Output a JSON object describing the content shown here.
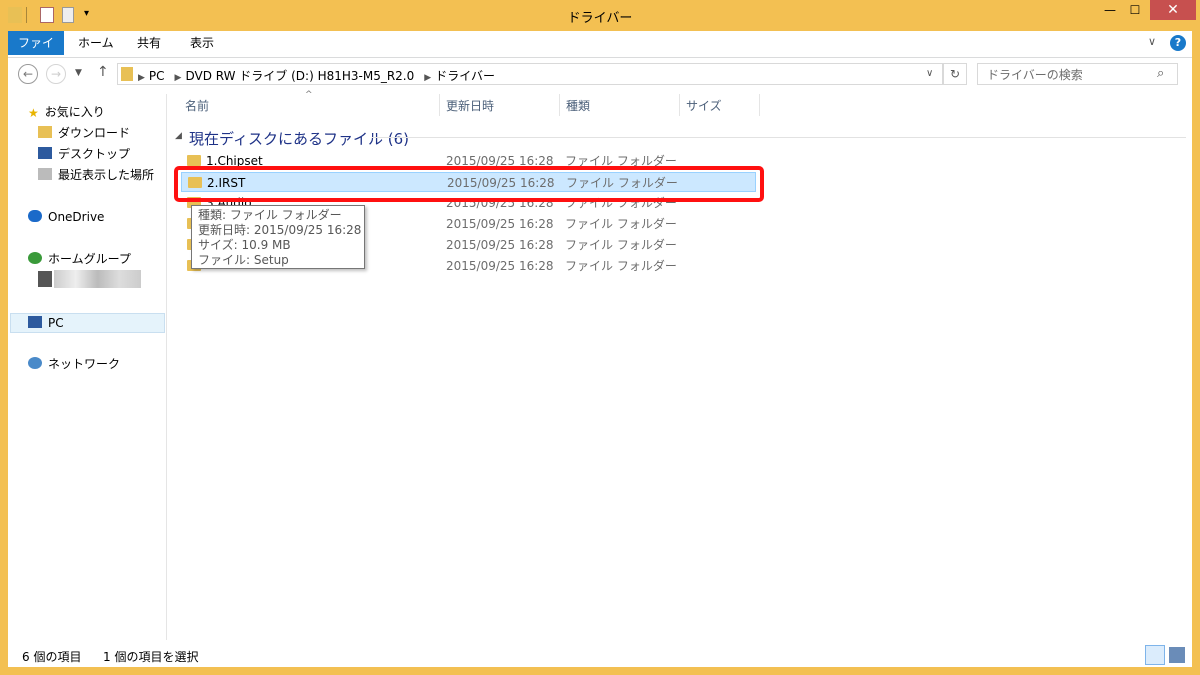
{
  "window": {
    "title": "ドライバー"
  },
  "ribbon": {
    "tabs": [
      "ファイル",
      "ホーム",
      "共有",
      "表示"
    ]
  },
  "address": {
    "crumbs": [
      "PC",
      "DVD RW ドライブ (D:) H81H3-M5_R2.0",
      "ドライバー"
    ]
  },
  "search": {
    "placeholder": "ドライバーの検索"
  },
  "nav": {
    "favorites": "お気に入り",
    "favorite_items": [
      "ダウンロード",
      "デスクトップ",
      "最近表示した場所"
    ],
    "onedrive": "OneDrive",
    "homegroup": "ホームグループ",
    "pc": "PC",
    "network": "ネットワーク"
  },
  "columns": {
    "name": "名前",
    "date": "更新日時",
    "type": "種類",
    "size": "サイズ"
  },
  "group": {
    "title": "現在ディスクにあるファイル (6)"
  },
  "files": [
    {
      "name": "1.Chipset",
      "date": "2015/09/25 16:28",
      "type": "ファイル フォルダー"
    },
    {
      "name": "2.IRST",
      "date": "2015/09/25 16:28",
      "type": "ファイル フォルダー",
      "selected": true
    },
    {
      "name": "3.Audio",
      "date": "2015/09/25 16:28",
      "type": "ファイル フォルダー"
    },
    {
      "name": "",
      "date": "2015/09/25 16:28",
      "type": "ファイル フォルダー"
    },
    {
      "name": "",
      "date": "2015/09/25 16:28",
      "type": "ファイル フォルダー"
    },
    {
      "name": "",
      "date": "2015/09/25 16:28",
      "type": "ファイル フォルダー"
    }
  ],
  "tooltip": {
    "line1": "種類: ファイル フォルダー",
    "line2": "更新日時: 2015/09/25 16:28",
    "line3": "サイズ: 10.9 MB",
    "line4": "ファイル: Setup"
  },
  "status": {
    "count": "6 個の項目",
    "selected": "1 個の項目を選択"
  },
  "colors": {
    "accent": "#1979ca",
    "frame": "#f3c052",
    "close": "#c7504f",
    "highlight": "#ff1010"
  }
}
